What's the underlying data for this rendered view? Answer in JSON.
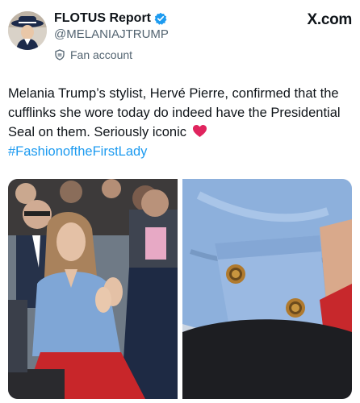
{
  "account": {
    "display_name": "FLOTUS Report",
    "handle": "@MELANIAJTRUMP",
    "label": "Fan account",
    "verified_color": "#1d9bf0"
  },
  "brand": "X.com",
  "tweet": {
    "text": "Melania Trump’s stylist, Hervé Pierre, confirmed that the cufflinks she wore today do indeed have the Presidential Seal on them. Seriously iconic",
    "emoji": "red-heart",
    "hashtag": "#FashionoftheFirstLady",
    "hashtag_color": "#1d9bf0"
  },
  "media": [
    {
      "name": "photo-woman-clapping",
      "description_icon": "photo"
    },
    {
      "name": "photo-cufflinks-closeup",
      "description_icon": "photo"
    }
  ]
}
